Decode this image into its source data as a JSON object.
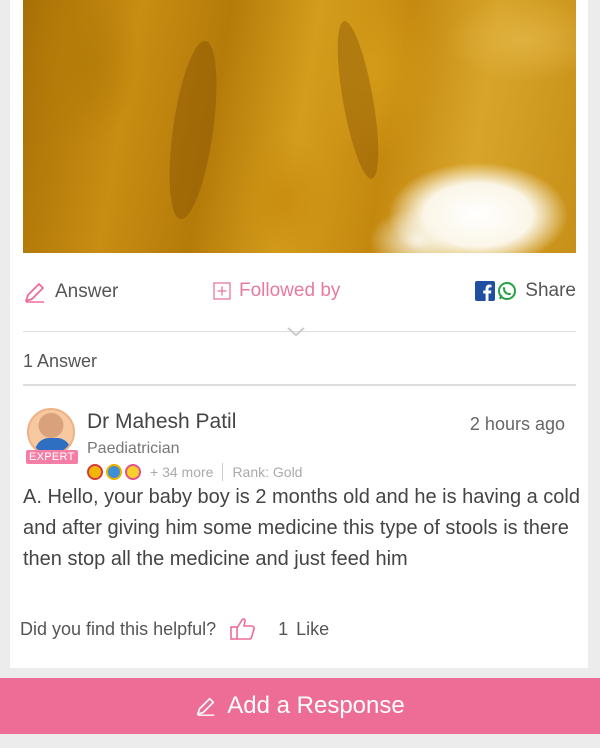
{
  "colors": {
    "accent_pink": "#ee6d96",
    "link_pink": "#e8799f",
    "facebook_blue": "#1f4fa0",
    "whatsapp_green": "#25a244"
  },
  "actions": {
    "answer_label": "Answer",
    "followed_label": "Followed by",
    "share_label": "Share"
  },
  "answers": {
    "count_label": "1 Answer"
  },
  "answer": {
    "expert_badge": "EXPERT",
    "doctor_name": "Dr Mahesh Patil",
    "specialty": "Paediatrician",
    "timestamp": "2 hours ago",
    "badges_more": "+ 34 more",
    "rank": "Rank: Gold",
    "text": "A. Hello, your baby boy is 2 months old and he is having a cold and after giving him some medicine this type of stools is there then stop all the medicine and just feed him",
    "helpful_question": "Did you find this helpful?",
    "like_count": "1",
    "like_label": "Like"
  },
  "footer": {
    "add_response_label": "Add a Response"
  },
  "icons": [
    "pencil-icon",
    "plus-square-icon",
    "facebook-icon",
    "whatsapp-icon",
    "chevron-down-icon",
    "thumbs-up-icon",
    "badge-icon"
  ]
}
